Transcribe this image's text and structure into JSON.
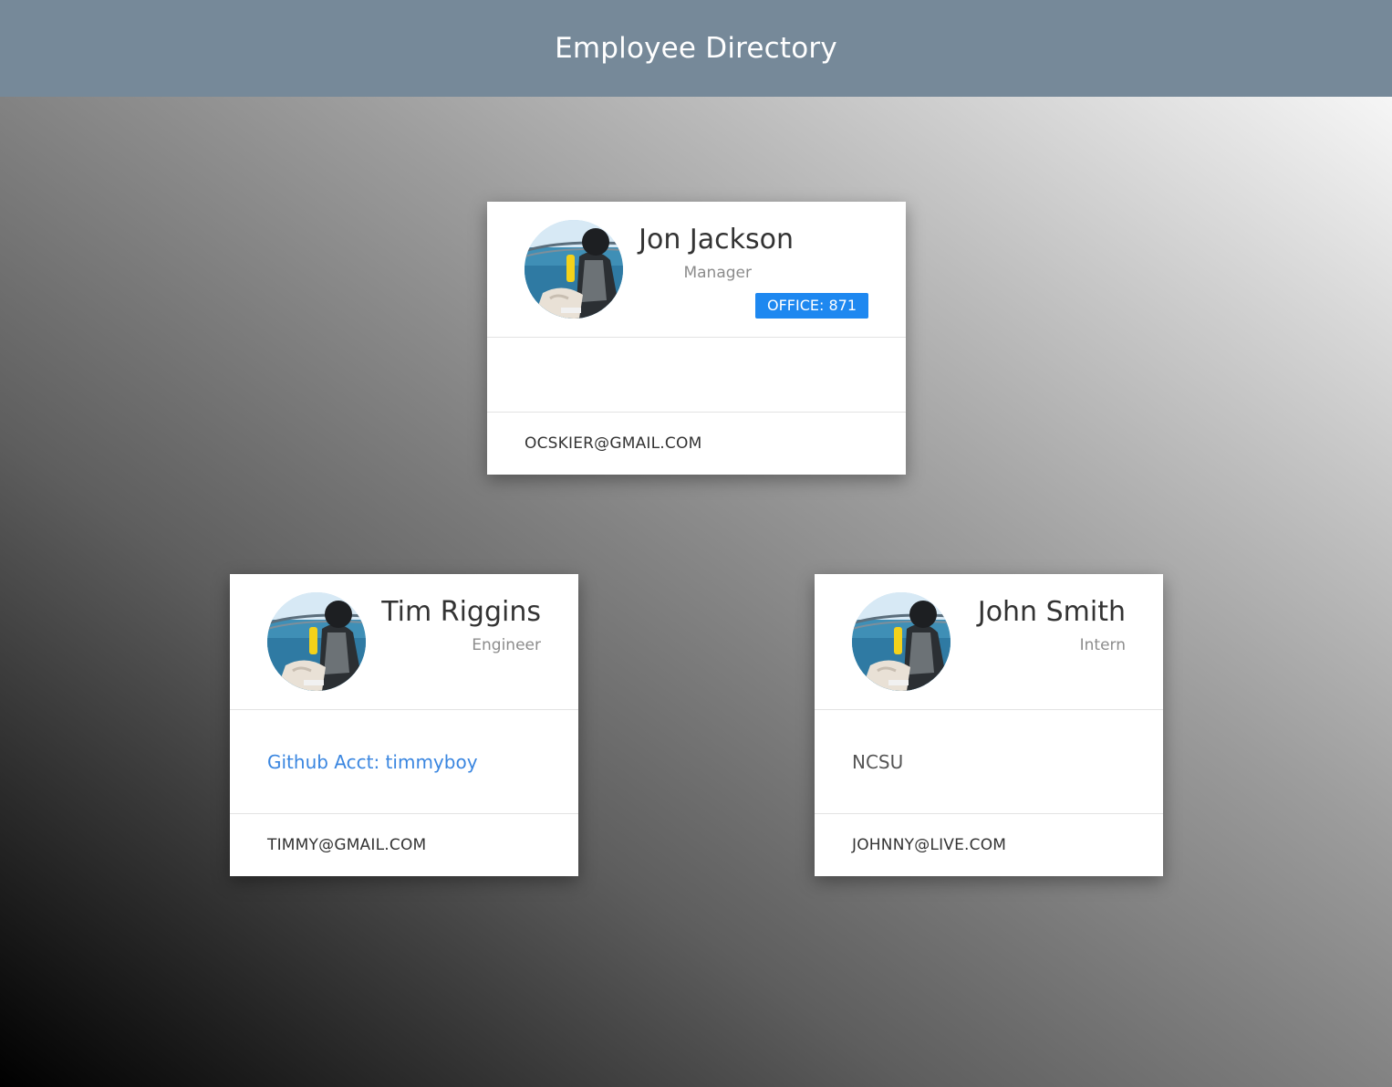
{
  "header": {
    "title": "Employee Directory"
  },
  "employees": [
    {
      "name": "Jon Jackson",
      "title": "Manager",
      "badge": "OFFICE: 871",
      "email": "OCSKIER@GMAIL.COM"
    },
    {
      "name": "Tim Riggins",
      "title": "Engineer",
      "detail": "Github Acct: timmyboy",
      "email": "TIMMY@GMAIL.COM"
    },
    {
      "name": "John Smith",
      "title": "Intern",
      "detail": "NCSU",
      "email": "JOHNNY@LIVE.COM"
    }
  ],
  "colors": {
    "header_bg": "#768999",
    "badge_bg": "#1e88f0",
    "link": "#3a86e0"
  }
}
